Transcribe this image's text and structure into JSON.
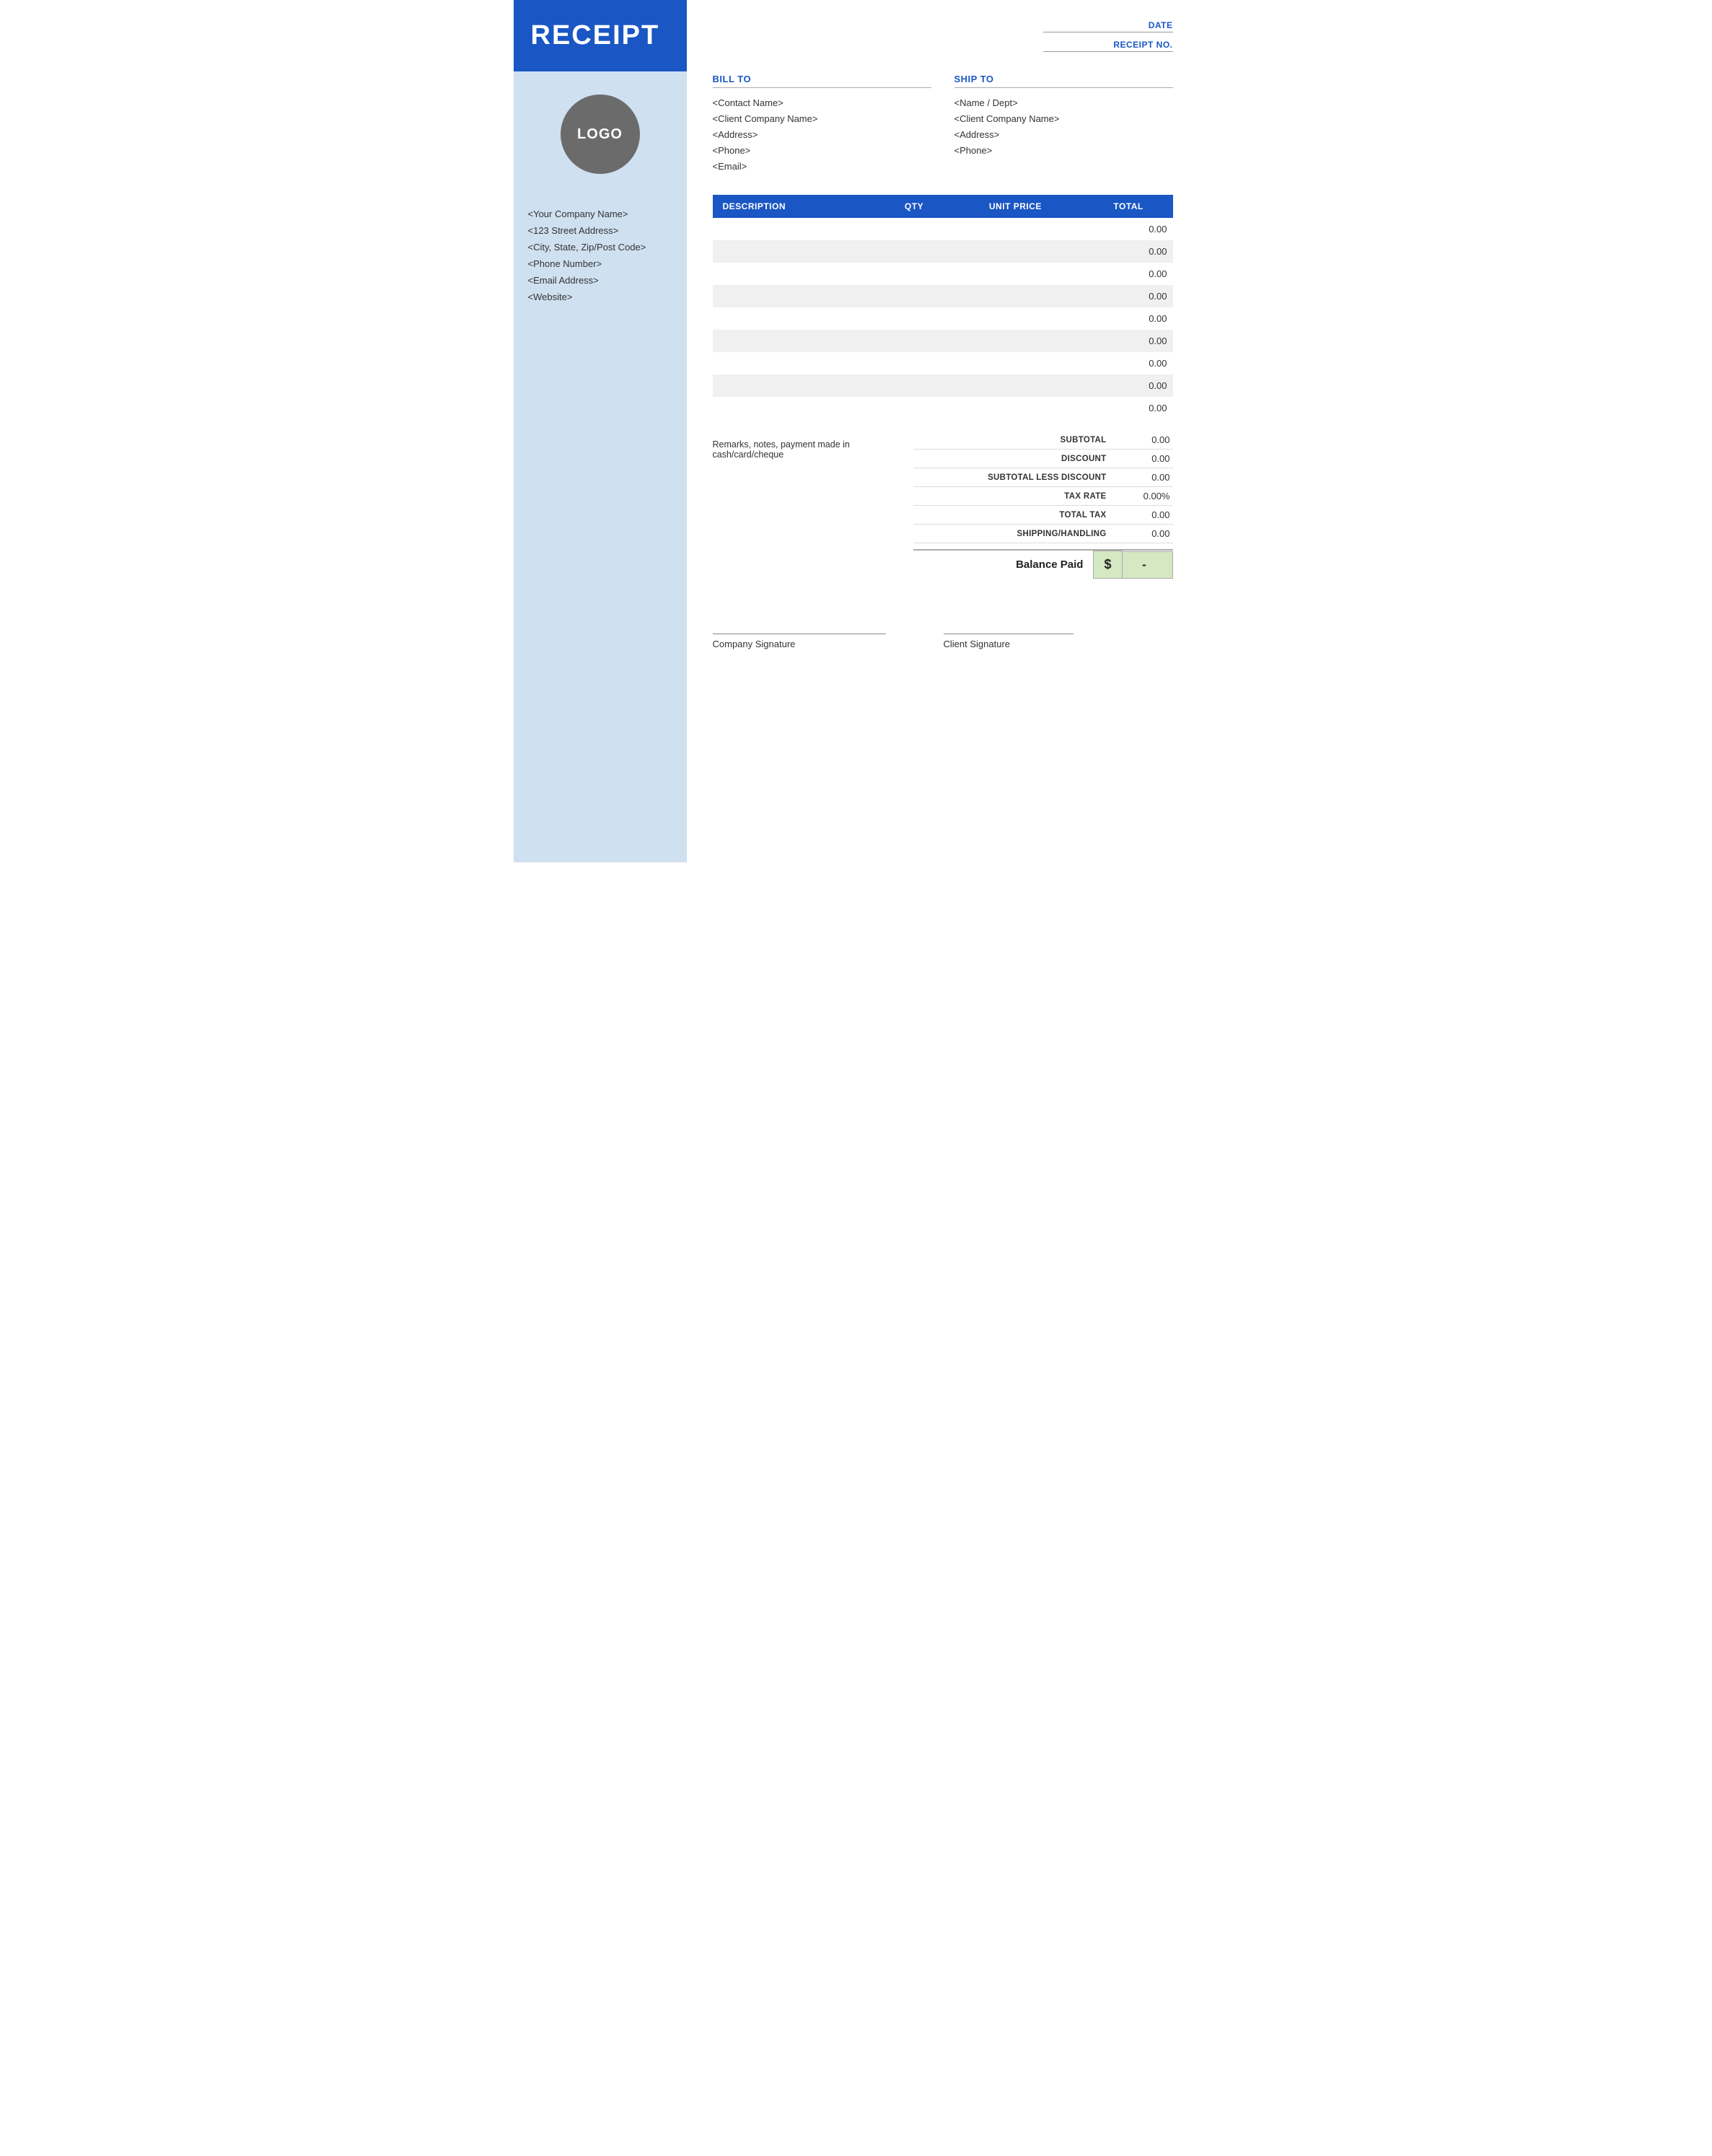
{
  "sidebar": {
    "header_title": "RECEIPT",
    "logo_text": "LOGO",
    "company_name": "<Your Company Name>",
    "street": "<123 Street Address>",
    "city": "<City, State, Zip/Post Code>",
    "phone": "<Phone Number>",
    "email": "<Email Address>",
    "website": "<Website>"
  },
  "header": {
    "date_label": "DATE",
    "receipt_no_label": "RECEIPT NO."
  },
  "bill_to": {
    "title": "BILL TO",
    "contact": "<Contact Name>",
    "company": "<Client Company Name>",
    "address": "<Address>",
    "phone": "<Phone>",
    "email": "<Email>"
  },
  "ship_to": {
    "title": "SHIP TO",
    "name_dept": "<Name / Dept>",
    "company": "<Client Company Name>",
    "address": "<Address>",
    "phone": "<Phone>"
  },
  "table": {
    "col_description": "DESCRIPTION",
    "col_qty": "QTY",
    "col_unit_price": "UNIT PRICE",
    "col_total": "TOTAL",
    "rows": [
      {
        "description": "",
        "qty": "",
        "unit_price": "",
        "total": "0.00"
      },
      {
        "description": "",
        "qty": "",
        "unit_price": "",
        "total": "0.00"
      },
      {
        "description": "",
        "qty": "",
        "unit_price": "",
        "total": "0.00"
      },
      {
        "description": "",
        "qty": "",
        "unit_price": "",
        "total": "0.00"
      },
      {
        "description": "",
        "qty": "",
        "unit_price": "",
        "total": "0.00"
      },
      {
        "description": "",
        "qty": "",
        "unit_price": "",
        "total": "0.00"
      },
      {
        "description": "",
        "qty": "",
        "unit_price": "",
        "total": "0.00"
      },
      {
        "description": "",
        "qty": "",
        "unit_price": "",
        "total": "0.00"
      },
      {
        "description": "",
        "qty": "",
        "unit_price": "",
        "total": "0.00"
      }
    ]
  },
  "remarks": "Remarks, notes, payment made in cash/card/cheque",
  "totals": {
    "subtotal_label": "SUBTOTAL",
    "subtotal_value": "0.00",
    "discount_label": "DISCOUNT",
    "discount_value": "0.00",
    "subtotal_less_label": "SUBTOTAL LESS DISCOUNT",
    "subtotal_less_value": "0.00",
    "tax_rate_label": "TAX RATE",
    "tax_rate_value": "0.00%",
    "total_tax_label": "TOTAL TAX",
    "total_tax_value": "0.00",
    "shipping_label": "SHIPPING/HANDLING",
    "shipping_value": "0.00",
    "balance_label": "Balance Paid",
    "balance_currency": "$",
    "balance_value": "-"
  },
  "signatures": {
    "company_label": "Company Signature",
    "client_label": "Client Signature"
  }
}
